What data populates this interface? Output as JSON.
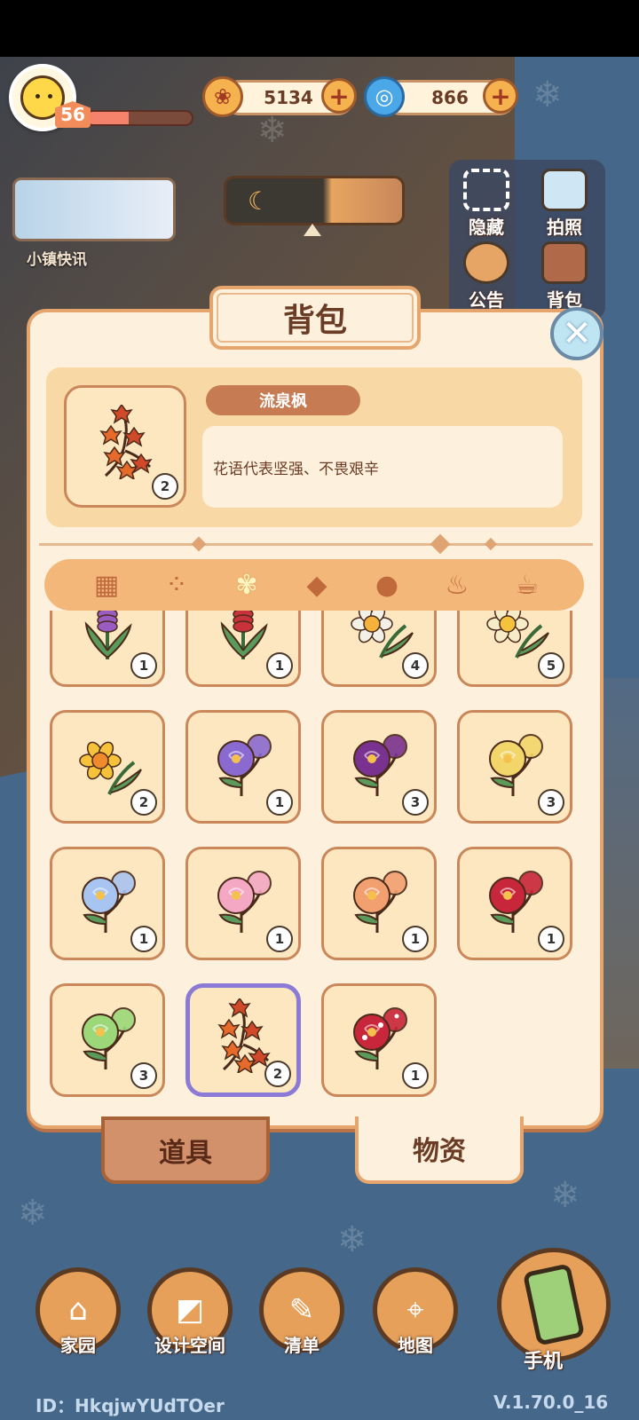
{
  "hud": {
    "level": "56",
    "exp_progress": 0.4,
    "coins": "5134",
    "gems": "866",
    "news_label": "小镇快讯"
  },
  "side_buttons": [
    {
      "label": "隐藏",
      "icon": "hide-icon"
    },
    {
      "label": "拍照",
      "icon": "camera-icon"
    },
    {
      "label": "公告",
      "icon": "announcement-icon"
    },
    {
      "label": "背包",
      "icon": "backpack-icon"
    }
  ],
  "bag": {
    "title": "背包",
    "selected_item": {
      "name": "流泉枫",
      "description": "花语代表坚强、不畏艰辛",
      "count": "2"
    },
    "categories": [
      {
        "icon": "grid-icon",
        "active": false
      },
      {
        "icon": "seed-packet-icon",
        "active": false
      },
      {
        "icon": "flower-sprig-icon",
        "active": true
      },
      {
        "icon": "fish-icon",
        "active": false
      },
      {
        "icon": "drumstick-icon",
        "active": false
      },
      {
        "icon": "hot-bowl-icon",
        "active": false
      },
      {
        "icon": "coffee-cup-icon",
        "active": false
      }
    ],
    "items": [
      {
        "kind": "spike",
        "color": "#9a5cc0",
        "count": "1"
      },
      {
        "kind": "spike",
        "color": "#c8323a",
        "count": "1"
      },
      {
        "kind": "daffodil",
        "color": "#f3f0e8",
        "center": "#f4b23c",
        "count": "4"
      },
      {
        "kind": "daffodil",
        "color": "#f7ecc8",
        "center": "#f4c23c",
        "count": "5"
      },
      {
        "kind": "daffodil",
        "color": "#f6c23a",
        "center": "#f08a2c",
        "count": "2"
      },
      {
        "kind": "rose",
        "color": "#8a6ad0",
        "count": "1"
      },
      {
        "kind": "rose",
        "color": "#7a3290",
        "count": "3"
      },
      {
        "kind": "rose",
        "color": "#f2d66a",
        "count": "3"
      },
      {
        "kind": "rose",
        "color": "#a8c4f0",
        "count": "1"
      },
      {
        "kind": "rose",
        "color": "#f4a8c4",
        "count": "1"
      },
      {
        "kind": "rose",
        "color": "#f2a070",
        "count": "1"
      },
      {
        "kind": "rose",
        "color": "#c8263a",
        "count": "1"
      },
      {
        "kind": "rose",
        "color": "#9cd87a",
        "count": "3"
      },
      {
        "kind": "maple",
        "color": "#d04a2a",
        "count": "2",
        "selected": true
      },
      {
        "kind": "rose",
        "color": "#c8263a",
        "spots": true,
        "count": "1"
      }
    ],
    "tab_items": "道具",
    "tab_materials": "物资"
  },
  "nav": [
    {
      "label": "家园",
      "icon": "home-icon"
    },
    {
      "label": "设计空间",
      "icon": "design-icon"
    },
    {
      "label": "清单",
      "icon": "list-icon"
    },
    {
      "label": "地图",
      "icon": "map-pin-icon"
    }
  ],
  "phone_label": "手机",
  "footer": {
    "id": "ID：HkqjwYUdTOer",
    "version": "V.1.70.0_16"
  }
}
